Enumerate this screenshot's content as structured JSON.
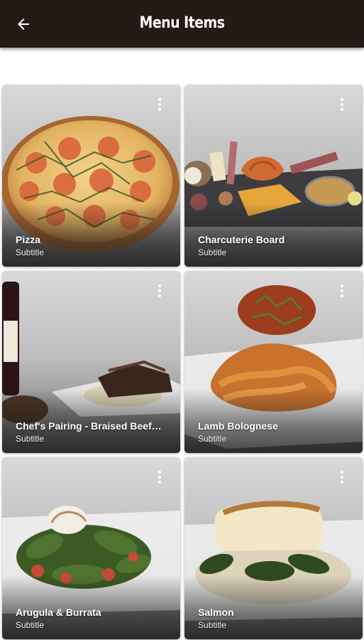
{
  "header": {
    "title": "Menu Items",
    "back_icon": "arrow-left-icon",
    "background_color": "#261a16"
  },
  "menu_items": [
    {
      "title": "Pizza",
      "subtitle": "Subtitle",
      "menu_icon": "more-vert-icon"
    },
    {
      "title": "Charcuterie Board",
      "subtitle": "Subtitle",
      "menu_icon": "more-vert-icon"
    },
    {
      "title": "Chef's Pairing - Braised Beef…",
      "subtitle": "Subtitle",
      "menu_icon": "more-vert-icon"
    },
    {
      "title": "Lamb Bolognese",
      "subtitle": "Subtitle",
      "menu_icon": "more-vert-icon"
    },
    {
      "title": "Arugula & Burrata",
      "subtitle": "Subtitle",
      "menu_icon": "more-vert-icon"
    },
    {
      "title": "Salmon",
      "subtitle": "Subtitle",
      "menu_icon": "more-vert-icon"
    }
  ]
}
